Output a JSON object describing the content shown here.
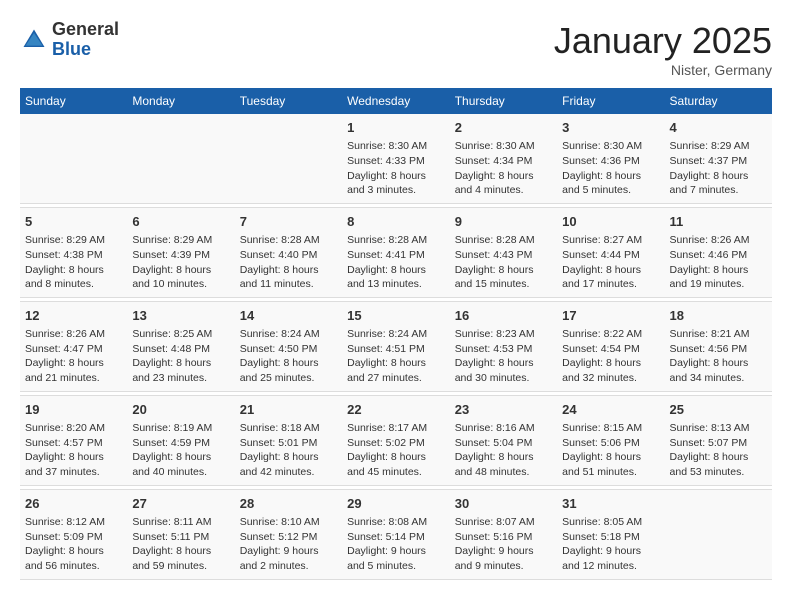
{
  "header": {
    "logo_general": "General",
    "logo_blue": "Blue",
    "title": "January 2025",
    "subtitle": "Nister, Germany"
  },
  "columns": [
    "Sunday",
    "Monday",
    "Tuesday",
    "Wednesday",
    "Thursday",
    "Friday",
    "Saturday"
  ],
  "weeks": [
    {
      "days": [
        {
          "num": "",
          "info": ""
        },
        {
          "num": "",
          "info": ""
        },
        {
          "num": "",
          "info": ""
        },
        {
          "num": "1",
          "info": "Sunrise: 8:30 AM\nSunset: 4:33 PM\nDaylight: 8 hours\nand 3 minutes."
        },
        {
          "num": "2",
          "info": "Sunrise: 8:30 AM\nSunset: 4:34 PM\nDaylight: 8 hours\nand 4 minutes."
        },
        {
          "num": "3",
          "info": "Sunrise: 8:30 AM\nSunset: 4:36 PM\nDaylight: 8 hours\nand 5 minutes."
        },
        {
          "num": "4",
          "info": "Sunrise: 8:29 AM\nSunset: 4:37 PM\nDaylight: 8 hours\nand 7 minutes."
        }
      ]
    },
    {
      "days": [
        {
          "num": "5",
          "info": "Sunrise: 8:29 AM\nSunset: 4:38 PM\nDaylight: 8 hours\nand 8 minutes."
        },
        {
          "num": "6",
          "info": "Sunrise: 8:29 AM\nSunset: 4:39 PM\nDaylight: 8 hours\nand 10 minutes."
        },
        {
          "num": "7",
          "info": "Sunrise: 8:28 AM\nSunset: 4:40 PM\nDaylight: 8 hours\nand 11 minutes."
        },
        {
          "num": "8",
          "info": "Sunrise: 8:28 AM\nSunset: 4:41 PM\nDaylight: 8 hours\nand 13 minutes."
        },
        {
          "num": "9",
          "info": "Sunrise: 8:28 AM\nSunset: 4:43 PM\nDaylight: 8 hours\nand 15 minutes."
        },
        {
          "num": "10",
          "info": "Sunrise: 8:27 AM\nSunset: 4:44 PM\nDaylight: 8 hours\nand 17 minutes."
        },
        {
          "num": "11",
          "info": "Sunrise: 8:26 AM\nSunset: 4:46 PM\nDaylight: 8 hours\nand 19 minutes."
        }
      ]
    },
    {
      "days": [
        {
          "num": "12",
          "info": "Sunrise: 8:26 AM\nSunset: 4:47 PM\nDaylight: 8 hours\nand 21 minutes."
        },
        {
          "num": "13",
          "info": "Sunrise: 8:25 AM\nSunset: 4:48 PM\nDaylight: 8 hours\nand 23 minutes."
        },
        {
          "num": "14",
          "info": "Sunrise: 8:24 AM\nSunset: 4:50 PM\nDaylight: 8 hours\nand 25 minutes."
        },
        {
          "num": "15",
          "info": "Sunrise: 8:24 AM\nSunset: 4:51 PM\nDaylight: 8 hours\nand 27 minutes."
        },
        {
          "num": "16",
          "info": "Sunrise: 8:23 AM\nSunset: 4:53 PM\nDaylight: 8 hours\nand 30 minutes."
        },
        {
          "num": "17",
          "info": "Sunrise: 8:22 AM\nSunset: 4:54 PM\nDaylight: 8 hours\nand 32 minutes."
        },
        {
          "num": "18",
          "info": "Sunrise: 8:21 AM\nSunset: 4:56 PM\nDaylight: 8 hours\nand 34 minutes."
        }
      ]
    },
    {
      "days": [
        {
          "num": "19",
          "info": "Sunrise: 8:20 AM\nSunset: 4:57 PM\nDaylight: 8 hours\nand 37 minutes."
        },
        {
          "num": "20",
          "info": "Sunrise: 8:19 AM\nSunset: 4:59 PM\nDaylight: 8 hours\nand 40 minutes."
        },
        {
          "num": "21",
          "info": "Sunrise: 8:18 AM\nSunset: 5:01 PM\nDaylight: 8 hours\nand 42 minutes."
        },
        {
          "num": "22",
          "info": "Sunrise: 8:17 AM\nSunset: 5:02 PM\nDaylight: 8 hours\nand 45 minutes."
        },
        {
          "num": "23",
          "info": "Sunrise: 8:16 AM\nSunset: 5:04 PM\nDaylight: 8 hours\nand 48 minutes."
        },
        {
          "num": "24",
          "info": "Sunrise: 8:15 AM\nSunset: 5:06 PM\nDaylight: 8 hours\nand 51 minutes."
        },
        {
          "num": "25",
          "info": "Sunrise: 8:13 AM\nSunset: 5:07 PM\nDaylight: 8 hours\nand 53 minutes."
        }
      ]
    },
    {
      "days": [
        {
          "num": "26",
          "info": "Sunrise: 8:12 AM\nSunset: 5:09 PM\nDaylight: 8 hours\nand 56 minutes."
        },
        {
          "num": "27",
          "info": "Sunrise: 8:11 AM\nSunset: 5:11 PM\nDaylight: 8 hours\nand 59 minutes."
        },
        {
          "num": "28",
          "info": "Sunrise: 8:10 AM\nSunset: 5:12 PM\nDaylight: 9 hours\nand 2 minutes."
        },
        {
          "num": "29",
          "info": "Sunrise: 8:08 AM\nSunset: 5:14 PM\nDaylight: 9 hours\nand 5 minutes."
        },
        {
          "num": "30",
          "info": "Sunrise: 8:07 AM\nSunset: 5:16 PM\nDaylight: 9 hours\nand 9 minutes."
        },
        {
          "num": "31",
          "info": "Sunrise: 8:05 AM\nSunset: 5:18 PM\nDaylight: 9 hours\nand 12 minutes."
        },
        {
          "num": "",
          "info": ""
        }
      ]
    }
  ]
}
